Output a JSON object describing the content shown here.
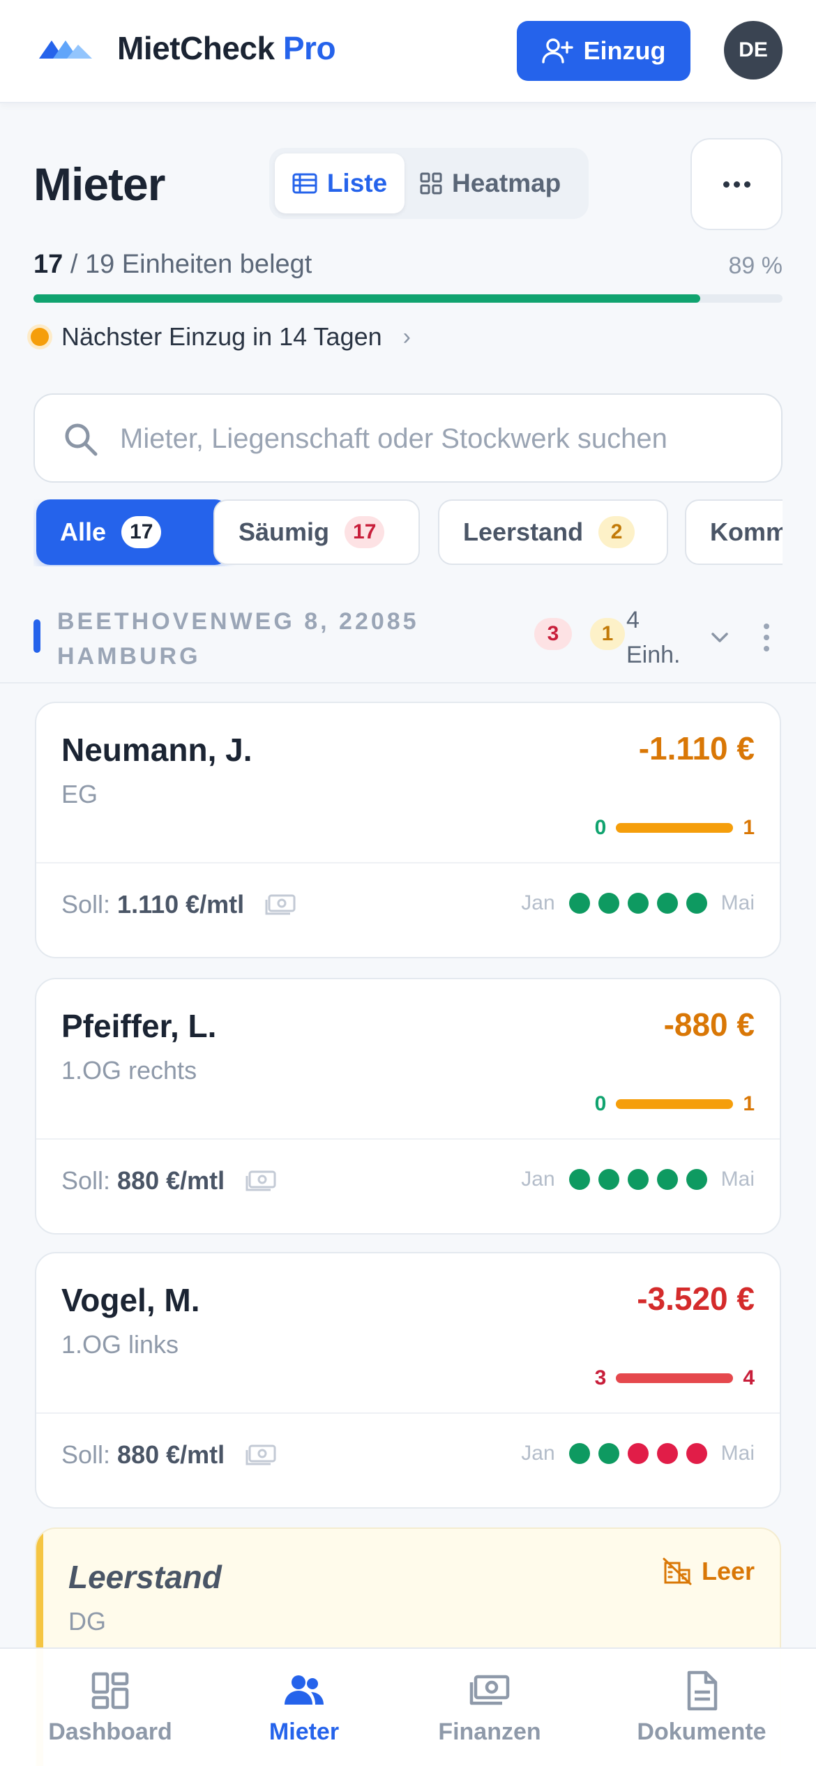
{
  "app": {
    "brand_main": "MietCheck",
    "brand_accent": "Pro",
    "accent_color": "#2563eb"
  },
  "header": {
    "einzug_label": "Einzug",
    "avatar_initials": "DE"
  },
  "page": {
    "title": "Mieter",
    "views": [
      {
        "label": "Liste",
        "icon": "list-icon",
        "active": true
      },
      {
        "label": "Heatmap",
        "icon": "grid-icon",
        "active": false
      }
    ],
    "more_icon": "more-horizontal-icon"
  },
  "occupancy": {
    "occupied": "17",
    "total_text": "/ 19 Einheiten belegt",
    "percent_label": "89 %",
    "percent": 0.89
  },
  "next_move_in": {
    "text": "Nächster Einzug in 14 Tagen"
  },
  "search": {
    "placeholder": "Mieter, Liegenschaft oder Stockwerk suchen"
  },
  "filters": [
    {
      "label": "Alle",
      "count": "17",
      "active": true
    },
    {
      "label": "Säumig",
      "count": "17",
      "active": false,
      "tone": "red"
    },
    {
      "label": "Leerstand",
      "count": "2",
      "active": false,
      "tone": "yellow"
    },
    {
      "label": "Kommende",
      "count": "",
      "active": false
    }
  ],
  "group": {
    "title": "BEETHOVENWEG 8, 22085 HAMBURG",
    "badge_red": "3",
    "badge_yellow": "1",
    "units": "4 Einh."
  },
  "tenants": [
    {
      "name": "Neumann, J.",
      "unit": "EG",
      "balance": "-1.110 €",
      "balance_color": "#d97706",
      "range_from": "0",
      "range_to": "1",
      "range_from_color": "#10a36f",
      "range_to_color": "#d97706",
      "range_bar_color": "#f59e0b",
      "soll_label": "Soll:",
      "soll_value": "1.110 €/mtl",
      "months_from": "Jan",
      "months_to": "Mai",
      "payments": [
        "#0e9a61",
        "#0e9a61",
        "#0e9a61",
        "#0e9a61",
        "#0e9a61"
      ]
    },
    {
      "name": "Pfeiffer, L.",
      "unit": "1.OG rechts",
      "balance": "-880 €",
      "balance_color": "#d97706",
      "range_from": "0",
      "range_to": "1",
      "range_from_color": "#10a36f",
      "range_to_color": "#d97706",
      "range_bar_color": "#f59e0b",
      "soll_label": "Soll:",
      "soll_value": "880 €/mtl",
      "months_from": "Jan",
      "months_to": "Mai",
      "payments": [
        "#0e9a61",
        "#0e9a61",
        "#0e9a61",
        "#0e9a61",
        "#0e9a61"
      ]
    },
    {
      "name": "Vogel, M.",
      "unit": "1.OG links",
      "balance": "-3.520 €",
      "balance_color": "#d42b2b",
      "range_from": "3",
      "range_to": "4",
      "range_from_color": "#c81e3a",
      "range_to_color": "#c81e3a",
      "range_bar_color": "#e5484d",
      "soll_label": "Soll:",
      "soll_value": "880 €/mtl",
      "months_from": "Jan",
      "months_to": "Mai",
      "payments": [
        "#0e9a61",
        "#0e9a61",
        "#e11d48",
        "#e11d48",
        "#e11d48"
      ]
    }
  ],
  "vacant": {
    "title": "Leerstand",
    "unit": "DG",
    "tag": "Leer"
  },
  "nav": [
    {
      "label": "Dashboard",
      "icon": "dashboard-icon",
      "active": false
    },
    {
      "label": "Mieter",
      "icon": "users-icon",
      "active": true
    },
    {
      "label": "Finanzen",
      "icon": "cash-icon",
      "active": false
    },
    {
      "label": "Dokumente",
      "icon": "document-icon",
      "active": false
    }
  ]
}
